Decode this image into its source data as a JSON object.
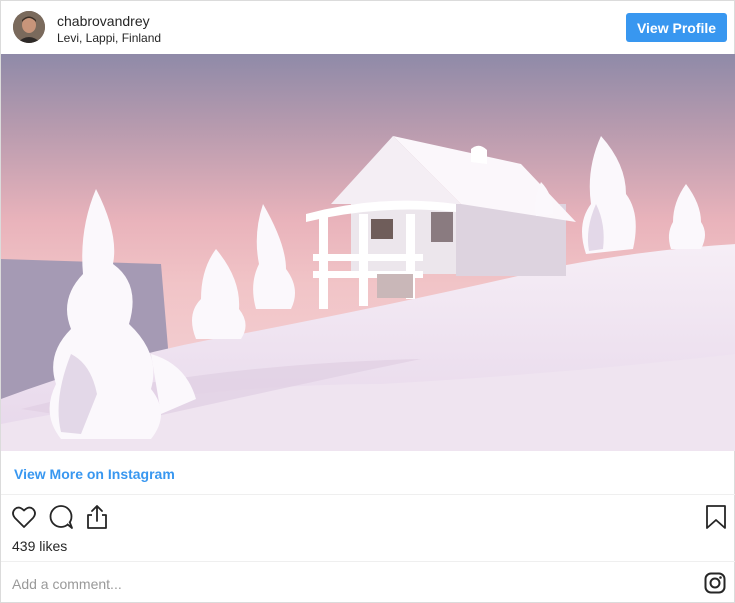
{
  "header": {
    "username": "chabrovandrey",
    "location": "Levi, Lappi, Finland",
    "view_profile_label": "View Profile"
  },
  "post": {
    "view_more_label": "View More on Instagram",
    "likes_text": "439 likes"
  },
  "comment": {
    "placeholder": "Add a comment..."
  },
  "icons": {
    "like": "heart-icon",
    "comment": "comment-icon",
    "share": "share-icon",
    "save": "bookmark-icon",
    "brand": "instagram-icon"
  },
  "colors": {
    "accent": "#3897f0",
    "text": "#262626",
    "muted": "#999999",
    "border": "#dbdbdb"
  }
}
